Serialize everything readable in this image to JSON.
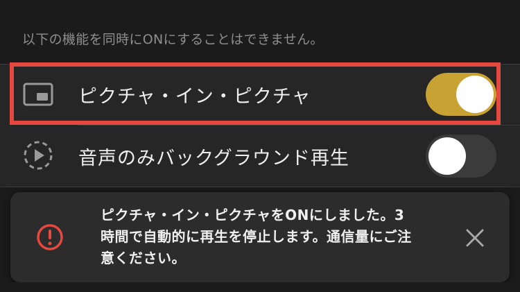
{
  "settings": {
    "note": "以下の機能を同時にONにすることはできません。",
    "items": [
      {
        "label": "ピクチャ・イン・ピクチャ",
        "icon": "picture-in-picture-icon",
        "state": "on"
      },
      {
        "label": "音声のみバックグラウンド再生",
        "icon": "background-play-icon",
        "state": "off"
      }
    ]
  },
  "toast": {
    "icon": "alert-circle-icon",
    "line1": "ピクチャ・イン・ピクチャをONにしました。3",
    "line2": "時間で自動的に再生を停止します。通信量にご注",
    "line3": "意ください。",
    "close_icon": "close-icon"
  },
  "colors": {
    "toggle_on": "#c9a234",
    "toggle_off": "#3b3b3b",
    "highlight": "#e5483f",
    "alert": "#e5483f",
    "background": "#1b1b1b",
    "row_background": "#262626",
    "toast_background": "#2c2c2c"
  }
}
